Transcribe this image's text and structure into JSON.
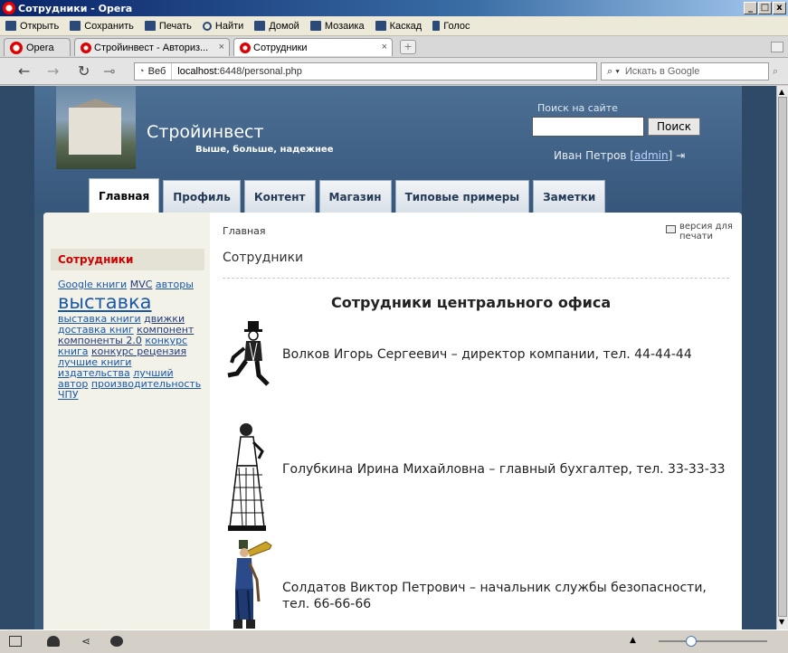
{
  "window": {
    "title": "Сотрудники - Opera",
    "min": "_",
    "max": "□",
    "close": "x"
  },
  "menu": [
    {
      "label": "Открыть",
      "icon": "folder-icon"
    },
    {
      "label": "Сохранить",
      "icon": "save-icon"
    },
    {
      "label": "Печать",
      "icon": "printer-icon"
    },
    {
      "label": "Найти",
      "icon": "search-icon"
    },
    {
      "label": "Домой",
      "icon": "home-icon"
    },
    {
      "label": "Мозаика",
      "icon": "tile-icon"
    },
    {
      "label": "Каскад",
      "icon": "cascade-icon"
    },
    {
      "label": "Голос",
      "icon": "voice-icon"
    }
  ],
  "tabs": {
    "opera_label": "Opera",
    "items": [
      {
        "label": "Стройинвест - Авториз...",
        "close": "×"
      },
      {
        "label": "Сотрудники",
        "close": "×"
      }
    ],
    "new_tab": "+"
  },
  "address": {
    "web_label": "Веб",
    "host": "localhost",
    "path": ":6448/personal.php",
    "search_placeholder": "Искать в Google"
  },
  "site": {
    "name": "Стройинвест",
    "slogan": "Выше, больше, надежнее",
    "search_label": "Поиск на сайте",
    "search_button": "Поиск",
    "user_name": "Иван Петров",
    "user_role": "admin",
    "nav": [
      "Главная",
      "Профиль",
      "Контент",
      "Магазин",
      "Типовые примеры",
      "Заметки"
    ]
  },
  "sidebar": {
    "heading": "Сотрудники",
    "tags": {
      "t1": "Google книги",
      "t2": "MVC",
      "t3": "авторы",
      "t4": "выставка",
      "t5": "выставка книги",
      "t6": "движки",
      "t7": "доставка книг",
      "t8": "компонент",
      "t9": "компоненты 2.0",
      "t10": "конкурс",
      "t11": "книга",
      "t12": "конкурс рецензия",
      "t13": "лучшие книги",
      "t14": "издательства",
      "t15": "лучший",
      "t16": "автор",
      "t17": "производительность",
      "t18": "ЧПУ"
    }
  },
  "content": {
    "breadcrumb": "Главная",
    "print_label": "версия для печати",
    "page_title": "Сотрудники",
    "section_title": "Сотрудники центрального офиса",
    "employees": [
      {
        "text": "Волков Игорь Сергеевич – директор компании, тел. 44-44-44",
        "image": "man-seated-figure"
      },
      {
        "text": "Голубкина Ирина Михайловна – главный бухгалтер, тел. 33-33-33",
        "image": "woman-standing-figure"
      },
      {
        "text": "Солдатов Виктор Петрович – начальник службы безопасности, тел. 66-66-66",
        "image": "soldier-trumpet-figure"
      }
    ]
  }
}
